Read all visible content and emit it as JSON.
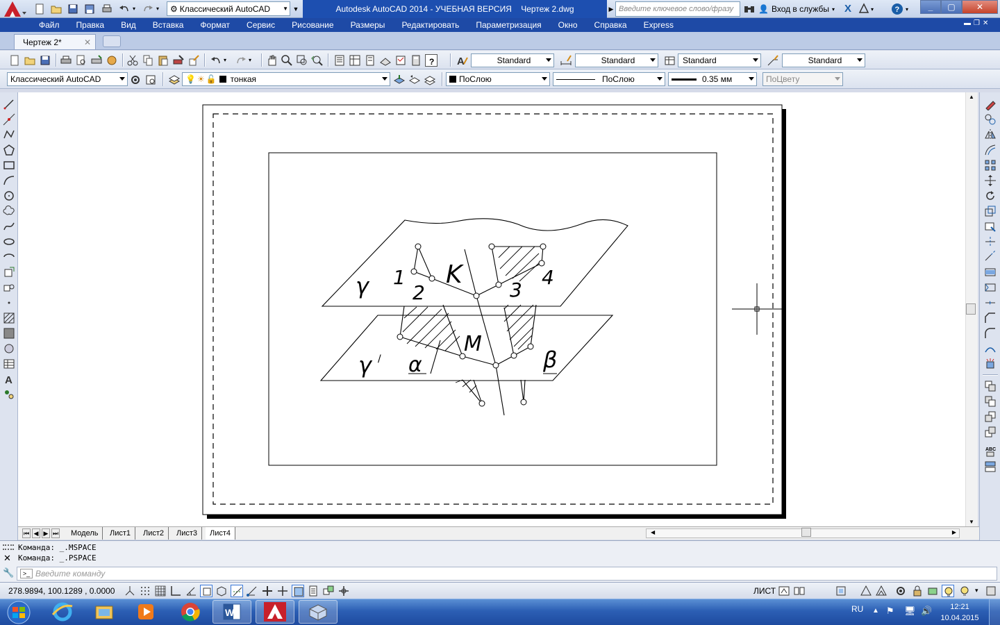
{
  "title": {
    "workspace": "Классический AutoCAD",
    "window_title": "Autodesk AutoCAD 2014 - УЧЕБНАЯ ВЕРСИЯ    Чертеж 2.dwg",
    "search_placeholder": "Введите ключевое слово/фразу",
    "signin": "Вход в службы"
  },
  "menu": [
    "Файл",
    "Правка",
    "Вид",
    "Вставка",
    "Формат",
    "Сервис",
    "Рисование",
    "Размеры",
    "Редактировать",
    "Параметризация",
    "Окно",
    "Справка",
    "Express"
  ],
  "doc_tab": {
    "label": "Чертеж 2*"
  },
  "toolbar1": {
    "text_style": "Standard",
    "dim_style": "Standard",
    "table_style": "Standard",
    "mleader_style": "Standard"
  },
  "toolbar2": {
    "workspace": "Классический AutoCAD",
    "layer": "тонкая",
    "color": "ПоСлою",
    "linetype": "ПоСлою",
    "lineweight": "0.35 мм",
    "plotstyle": "ПоЦвету"
  },
  "drawing_labels": {
    "gamma_top": "γ",
    "p1": "1",
    "p2": "2",
    "K": "K",
    "p3": "3",
    "p4": "4",
    "gamma_bottom": "γ",
    "prime": "/",
    "alpha": "α",
    "M": "M",
    "beta": "β"
  },
  "layout_tabs": [
    "Модель",
    "Лист1",
    "Лист2",
    "Лист3",
    "Лист4"
  ],
  "active_layout": "Лист4",
  "command": {
    "history": [
      "Команда:  _.MSPACE",
      "Команда:  _.PSPACE"
    ],
    "placeholder": "Введите команду"
  },
  "status": {
    "coords": "278.9894, 100.1289 , 0.0000",
    "sheet": "ЛИСТ"
  },
  "taskbar": {
    "lang": "RU",
    "time": "12:21",
    "date": "10.04.2015"
  },
  "colors": {
    "menubar": "#1e4aa6",
    "titlebar_active": "#1d4fb0",
    "autocad_red": "#c8202a"
  }
}
